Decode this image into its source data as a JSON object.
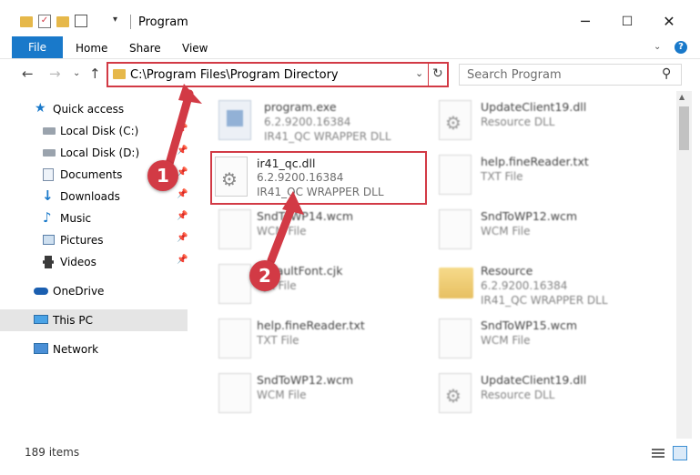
{
  "window": {
    "title": "Program"
  },
  "ribbon": {
    "file": "File",
    "tabs": [
      "Home",
      "Share",
      "View"
    ]
  },
  "nav": {
    "address": "C:\\Program Files\\Program Directory",
    "search_placeholder": "Search Program"
  },
  "sidebar": {
    "items": [
      {
        "label": "Quick access",
        "icon": "star-icon"
      },
      {
        "label": "Local Disk (C:)",
        "icon": "drive-icon",
        "pinned": true
      },
      {
        "label": "Local Disk (D:)",
        "icon": "drive-icon",
        "pinned": true
      },
      {
        "label": "Documents",
        "icon": "documents-icon",
        "pinned": true
      },
      {
        "label": "Downloads",
        "icon": "download-icon",
        "pinned": true
      },
      {
        "label": "Music",
        "icon": "music-icon",
        "pinned": true
      },
      {
        "label": "Pictures",
        "icon": "pictures-icon",
        "pinned": true
      },
      {
        "label": "Videos",
        "icon": "videos-icon",
        "pinned": true
      },
      {
        "label": "OneDrive",
        "icon": "cloud-icon"
      },
      {
        "label": "This PC",
        "icon": "computer-icon",
        "selected": true
      },
      {
        "label": "Network",
        "icon": "network-icon"
      }
    ]
  },
  "files": [
    {
      "name": "program.exe",
      "line2": "6.2.9200.16384",
      "line3": "IR41_QC WRAPPER DLL",
      "icon": "exe-icon"
    },
    {
      "name": "UpdateClient19.dll",
      "line2": "Resource DLL",
      "icon": "dll-icon"
    },
    {
      "name": "ir41_qc.dll",
      "line2": "6.2.9200.16384",
      "line3": "IR41_QC WRAPPER DLL",
      "icon": "dll-icon",
      "highlighted": true
    },
    {
      "name": "help.fineReader.txt",
      "line2": "TXT File",
      "icon": "file-icon"
    },
    {
      "name": "SndToWP14.wcm",
      "line2": "WCM File",
      "icon": "file-icon"
    },
    {
      "name": "SndToWP12.wcm",
      "line2": "WCM File",
      "icon": "file-icon"
    },
    {
      "name": "DefaultFont.cjk",
      "line2": "CJK File",
      "icon": "file-icon"
    },
    {
      "name": "Resource",
      "line2": "6.2.9200.16384",
      "line3": "IR41_QC WRAPPER DLL",
      "icon": "folder-icon"
    },
    {
      "name": "help.fineReader.txt",
      "line2": "TXT File",
      "icon": "file-icon"
    },
    {
      "name": "SndToWP15.wcm",
      "line2": "WCM File",
      "icon": "file-icon"
    },
    {
      "name": "SndToWP12.wcm",
      "line2": "WCM File",
      "icon": "file-icon"
    },
    {
      "name": "UpdateClient19.dll",
      "line2": "Resource DLL",
      "icon": "dll-icon"
    }
  ],
  "status": {
    "count": "189 items"
  },
  "callouts": [
    "1",
    "2"
  ],
  "colors": {
    "accent": "#1979ca",
    "highlight": "#d23a45",
    "selected": "#e5e5e5"
  }
}
